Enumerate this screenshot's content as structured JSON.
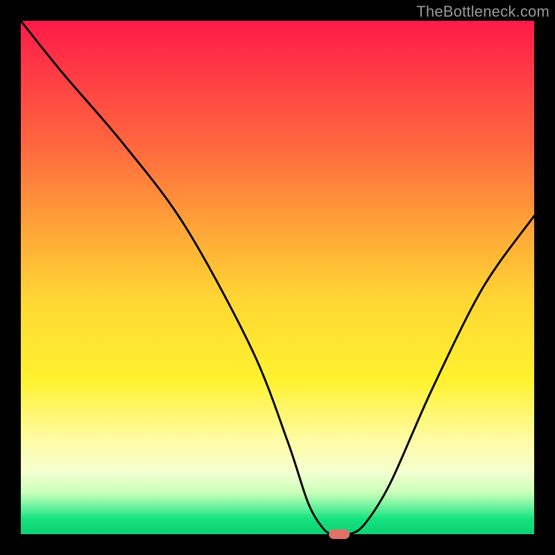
{
  "watermark": "TheBottleneck.com",
  "chart_data": {
    "type": "line",
    "title": "",
    "xlabel": "",
    "ylabel": "",
    "xlim": [
      0,
      100
    ],
    "ylim": [
      0,
      100
    ],
    "x": [
      0,
      8,
      20,
      32,
      45,
      52,
      56,
      59,
      61,
      64,
      67,
      72,
      80,
      90,
      100
    ],
    "values": [
      100,
      90,
      76,
      60,
      36,
      18,
      6,
      1,
      0,
      0,
      2,
      10,
      28,
      48,
      62
    ],
    "annotations": [
      {
        "type": "marker",
        "x": 62,
        "y": 0,
        "color": "#e0726a"
      }
    ],
    "gradient_stops": [
      {
        "pos": 0,
        "color": "#ff1a49"
      },
      {
        "pos": 10,
        "color": "#ff3b45"
      },
      {
        "pos": 25,
        "color": "#ff6a3e"
      },
      {
        "pos": 40,
        "color": "#ffa438"
      },
      {
        "pos": 55,
        "color": "#ffd833"
      },
      {
        "pos": 70,
        "color": "#fff22f"
      },
      {
        "pos": 82,
        "color": "#fffca8"
      },
      {
        "pos": 88,
        "color": "#f4ffd0"
      },
      {
        "pos": 92,
        "color": "#c7ffb8"
      },
      {
        "pos": 95,
        "color": "#5ff09a"
      },
      {
        "pos": 97,
        "color": "#16e27f"
      },
      {
        "pos": 100,
        "color": "#0dd174"
      }
    ]
  },
  "marker": {
    "color": "#e0726a"
  }
}
